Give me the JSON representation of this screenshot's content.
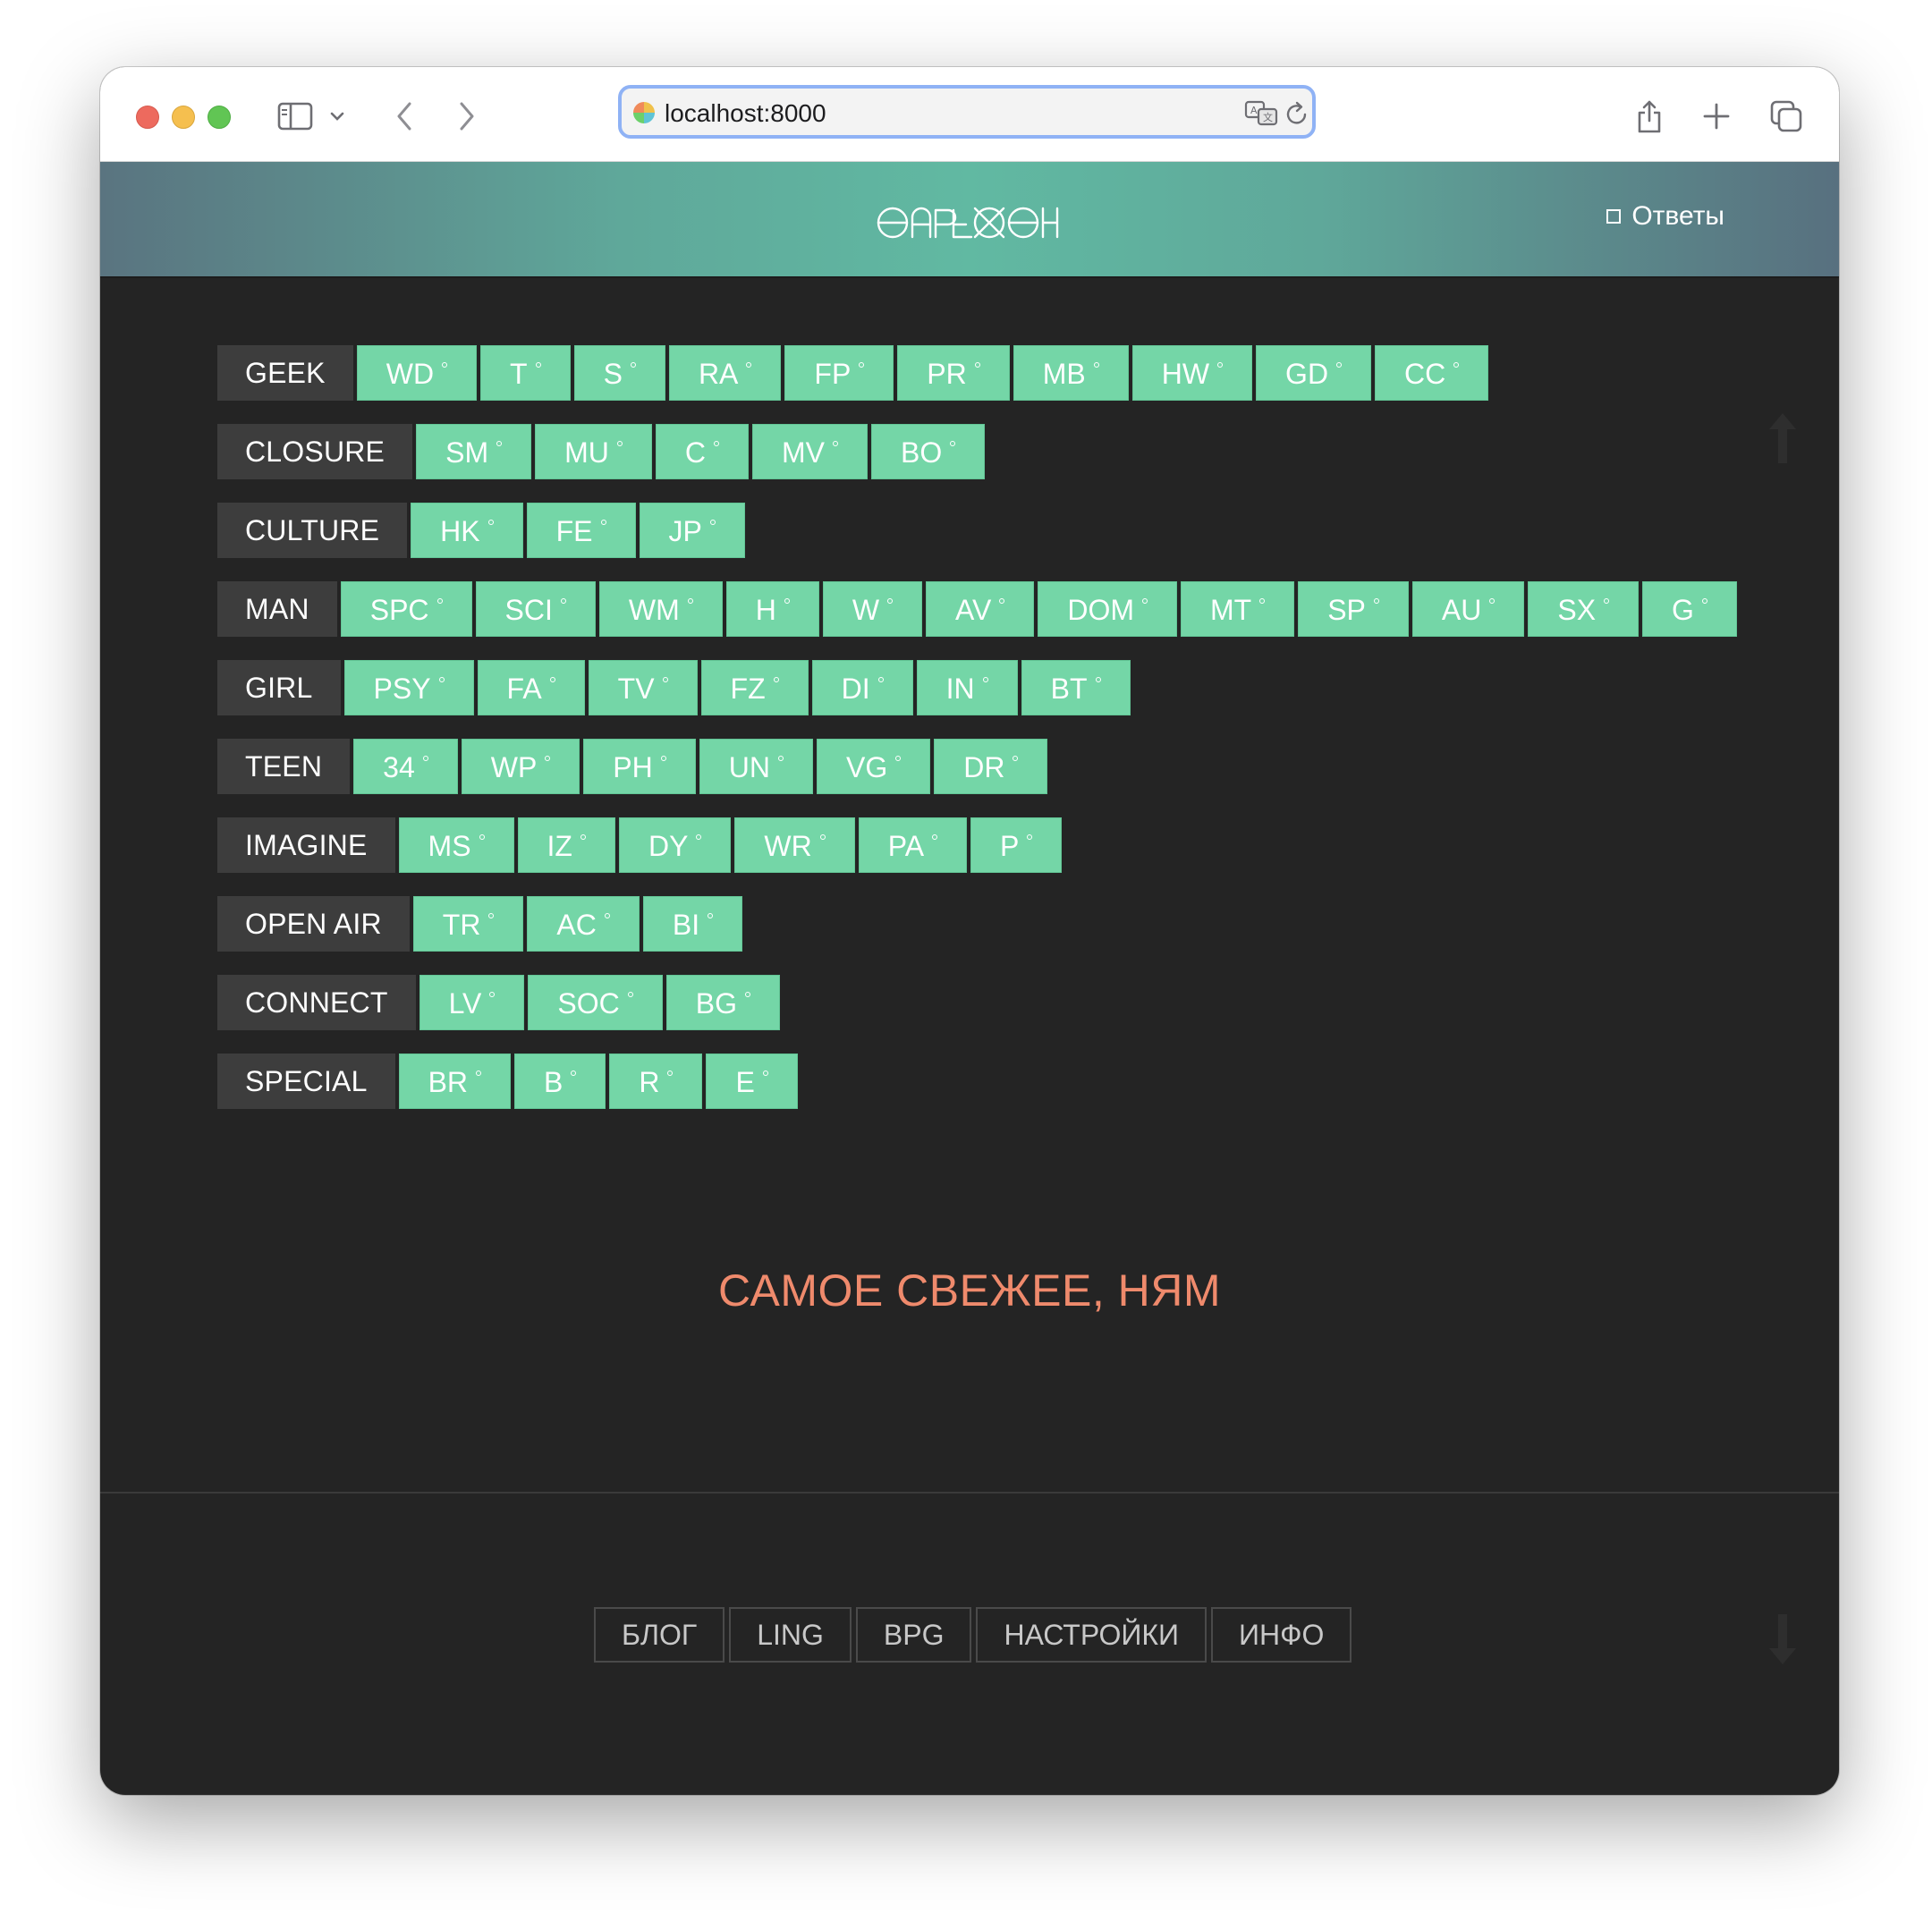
{
  "browser": {
    "url": "localhost:8000"
  },
  "header": {
    "answers_label": "Ответы"
  },
  "categories": [
    {
      "label": "GEEK",
      "boards": [
        "WD",
        "T",
        "S",
        "RA",
        "FP",
        "PR",
        "MB",
        "HW",
        "GD",
        "CC"
      ]
    },
    {
      "label": "CLOSURE",
      "boards": [
        "SM",
        "MU",
        "C",
        "MV",
        "BO"
      ]
    },
    {
      "label": "CULTURE",
      "boards": [
        "HK",
        "FE",
        "JP"
      ]
    },
    {
      "label": "MAN",
      "boards": [
        "SPC",
        "SCI",
        "WM",
        "H",
        "W",
        "AV",
        "DOM",
        "MT",
        "SP",
        "AU",
        "SX",
        "G"
      ]
    },
    {
      "label": "GIRL",
      "boards": [
        "PSY",
        "FA",
        "TV",
        "FZ",
        "DI",
        "IN",
        "BT"
      ]
    },
    {
      "label": "TEEN",
      "boards": [
        "34",
        "WP",
        "PH",
        "UN",
        "VG",
        "DR"
      ]
    },
    {
      "label": "IMAGINE",
      "boards": [
        "MS",
        "IZ",
        "DY",
        "WR",
        "PA",
        "P"
      ]
    },
    {
      "label": "OPEN AIR",
      "boards": [
        "TR",
        "AC",
        "BI"
      ]
    },
    {
      "label": "CONNECT",
      "boards": [
        "LV",
        "SOC",
        "BG"
      ]
    },
    {
      "label": "SPECIAL",
      "boards": [
        "BR",
        "B",
        "R",
        "E"
      ]
    }
  ],
  "fresh_heading": "САМОЕ СВЕЖЕЕ, НЯМ",
  "footer_nav": [
    "БЛОГ",
    "LING",
    "BPG",
    "НАСТРОЙКИ",
    "ИНФО"
  ],
  "colors": {
    "board_bg": "#74d6a7",
    "category_bg": "#3d3d3d",
    "accent_heading": "#ef8a6c",
    "page_bg": "#242424"
  }
}
